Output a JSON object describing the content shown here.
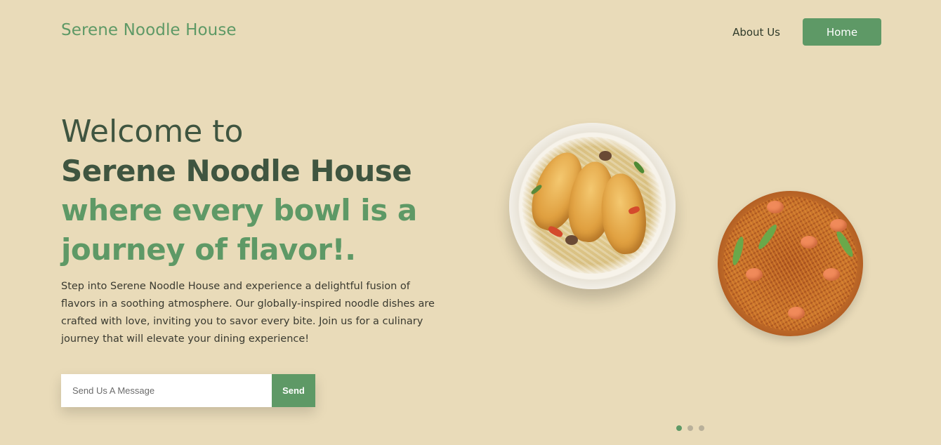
{
  "header": {
    "brand": "Serene Noodle House",
    "nav": {
      "about": "About Us",
      "home": "Home"
    }
  },
  "hero": {
    "welcome": "Welcome to",
    "name": "Serene Noodle House",
    "tagline": "where every bowl is a journey of flavor!.",
    "description": "Step into Serene Noodle House and experience a delightful fusion of flavors in a soothing atmosphere. Our globally-inspired noodle dishes are crafted with love, inviting you to savor every bite. Join us for a culinary journey that will elevate your dining experience!"
  },
  "form": {
    "placeholder": "Send Us A Message",
    "value": "",
    "send_label": "Send"
  },
  "carousel": {
    "slide_count": 3,
    "active_index": 0
  },
  "colors": {
    "background": "#e9dbb9",
    "accent": "#5e9966",
    "heading": "#3f5540"
  }
}
